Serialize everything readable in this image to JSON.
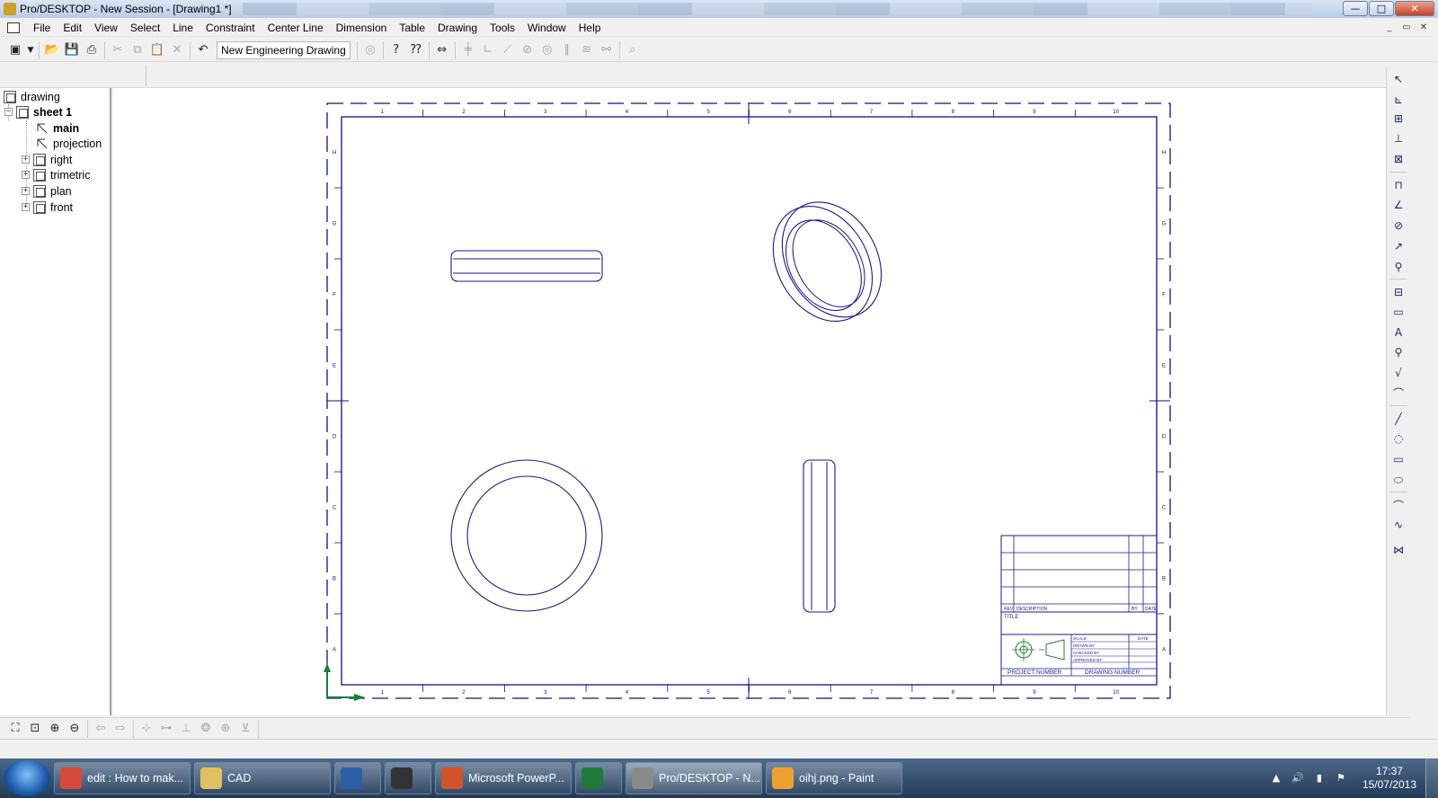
{
  "window": {
    "title": "Pro/DESKTOP - New Session - [Drawing1 *]",
    "min": "—",
    "max": "□",
    "close": "✕"
  },
  "mdi": {
    "min": "_",
    "restore": "▭",
    "close": "✕"
  },
  "menu": [
    "File",
    "Edit",
    "View",
    "Select",
    "Line",
    "Constraint",
    "Center Line",
    "Dimension",
    "Table",
    "Drawing",
    "Tools",
    "Window",
    "Help"
  ],
  "toolbar": {
    "template_value": "New Engineering Drawing"
  },
  "tree": {
    "root": "drawing",
    "sheet": "sheet 1",
    "items": [
      {
        "label": "main",
        "bold": true,
        "expandable": false,
        "expander": ""
      },
      {
        "label": "projection",
        "bold": false,
        "expandable": false,
        "expander": ""
      },
      {
        "label": "right",
        "bold": false,
        "expandable": true,
        "expander": "+"
      },
      {
        "label": "trimetric",
        "bold": false,
        "expandable": true,
        "expander": "+"
      },
      {
        "label": "plan",
        "bold": false,
        "expandable": true,
        "expander": "+"
      },
      {
        "label": "front",
        "bold": false,
        "expandable": true,
        "expander": "+"
      }
    ],
    "sheet_expander": "−"
  },
  "drawing": {
    "line_color": "#1a1a8c",
    "frame_color": "#101080",
    "col_labels": [
      "1",
      "2",
      "3",
      "4",
      "5",
      "6",
      "7",
      "8",
      "9",
      "10"
    ],
    "row_labels": [
      "H",
      "G",
      "F",
      "E",
      "D",
      "C",
      "B",
      "A"
    ],
    "title_block": {
      "rev": "REV",
      "description": "DESCRIPTION",
      "by": "BY",
      "date": "DATE",
      "title": "TITLE",
      "scale": "SCALE",
      "date2": "DATE",
      "drawn_by": "DRAWN BY",
      "checked_by": "CHECKED BY",
      "approved_by": "APPROVED BY",
      "project_number": "PROJECT NUMBER",
      "drawing_number": "DRAWING NUMBER"
    }
  },
  "taskbar": {
    "items": [
      {
        "label": "edit : How to mak...",
        "icon_color": "#d44b3b",
        "active": false
      },
      {
        "label": "CAD",
        "icon_color": "#e0c060",
        "active": false
      },
      {
        "label": "",
        "icon_color": "#2b5faa",
        "active": false
      },
      {
        "label": "",
        "icon_color": "#333333",
        "active": false
      },
      {
        "label": "Microsoft PowerP...",
        "icon_color": "#d2532c",
        "active": false
      },
      {
        "label": "",
        "icon_color": "#1f7a3a",
        "active": false
      },
      {
        "label": "Pro/DESKTOP - N...",
        "icon_color": "#8a8a8a",
        "active": true
      },
      {
        "label": "oihj.png - Paint",
        "icon_color": "#f0a030",
        "active": false
      }
    ],
    "clock_time": "17:37",
    "clock_date": "15/07/2013"
  },
  "icons": {
    "toolbar": [
      "new-drawing-icon",
      "open-folder-icon",
      "save-icon",
      "print-icon",
      "cut-icon",
      "copy-icon",
      "paste-icon",
      "delete-icon",
      "undo-icon",
      "template-settings-icon",
      "help-icon",
      "context-help-icon",
      "zoom-window-icon",
      "constraint-horizontal-icon",
      "constraint-perpendicular-icon",
      "constraint-angle-icon",
      "constraint-tangent-icon",
      "constraint-concentric-icon",
      "constraint-parallel-icon",
      "constraint-equal-icon",
      "constraint-coincident-icon",
      "find-icon"
    ],
    "bottom": [
      "zoom-fit-icon",
      "zoom-area-icon",
      "zoom-in-icon",
      "zoom-out-icon",
      "back-icon",
      "forward-icon",
      "pan-icon",
      "rotate-icon",
      "dimension-icon",
      "snap-icon",
      "center-icon",
      "measure-icon"
    ]
  }
}
